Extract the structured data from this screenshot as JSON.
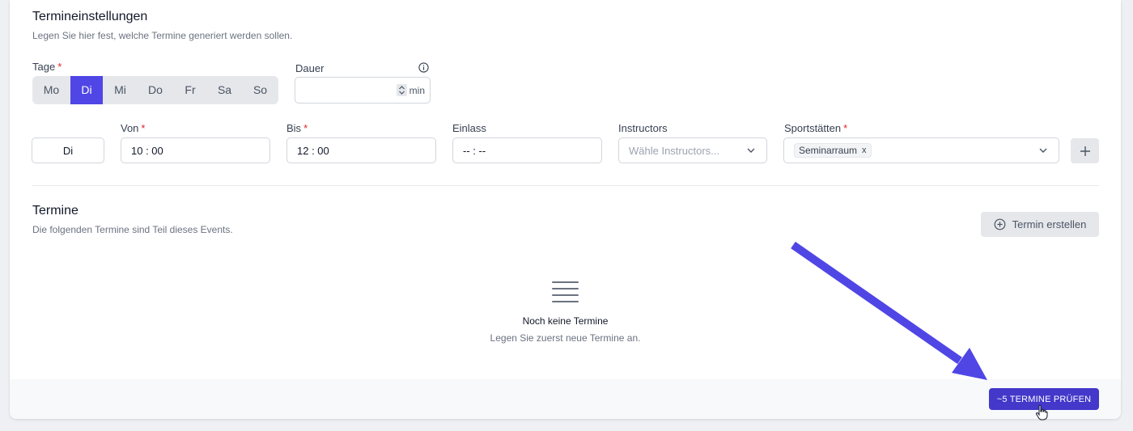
{
  "settings": {
    "title": "Termineinstellungen",
    "subtitle": "Legen Sie hier fest, welche Termine generiert werden sollen."
  },
  "days": {
    "label": "Tage",
    "required_mark": "*",
    "items": [
      {
        "label": "Mo",
        "active": false
      },
      {
        "label": "Di",
        "active": true
      },
      {
        "label": "Mi",
        "active": false
      },
      {
        "label": "Do",
        "active": false
      },
      {
        "label": "Fr",
        "active": false
      },
      {
        "label": "Sa",
        "active": false
      },
      {
        "label": "So",
        "active": false
      }
    ]
  },
  "duration": {
    "label": "Dauer",
    "value": "",
    "unit": "min",
    "info_icon": "info-circle-icon"
  },
  "schedule_row": {
    "day": "Di",
    "from": {
      "label": "Von",
      "required_mark": "*",
      "value": "10 : 00"
    },
    "to": {
      "label": "Bis",
      "required_mark": "*",
      "value": "12 : 00"
    },
    "admission": {
      "label": "Einlass",
      "value": "-- : --"
    },
    "instructors": {
      "label": "Instructors",
      "placeholder": "Wähle Instructors..."
    },
    "venues": {
      "label": "Sportstätten",
      "required_mark": "*",
      "selected": [
        "Seminarraum"
      ],
      "remove_glyph": "x"
    }
  },
  "termine": {
    "title": "Termine",
    "subtitle": "Die folgenden Termine sind Teil dieses Events.",
    "create_button": "Termin erstellen"
  },
  "empty_state": {
    "title": "Noch keine Termine",
    "subtitle": "Legen Sie zuerst neue Termine an."
  },
  "footer": {
    "check_button": "~5 TERMINE PRÜFEN"
  },
  "colors": {
    "accent": "#4f46e5",
    "primary_button": "#4338ca",
    "annotation_arrow": "#4f46e5",
    "required": "#dc2626"
  }
}
